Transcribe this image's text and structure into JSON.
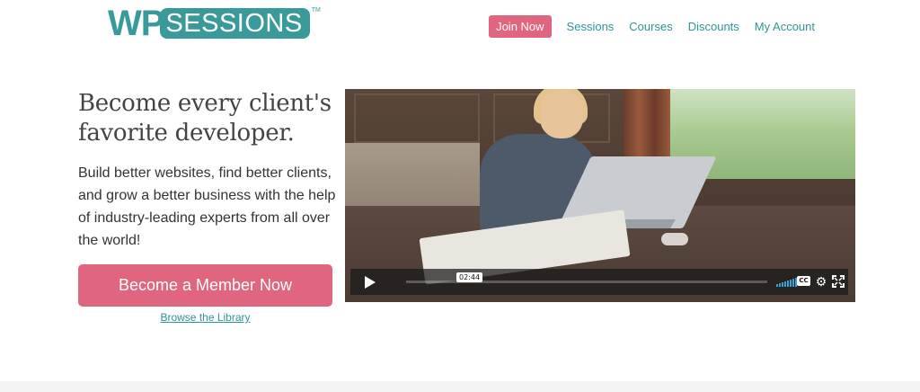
{
  "brand": {
    "logo_wp": "WP",
    "logo_sessions": "SESSIONS",
    "logo_tm": "TM",
    "primary_color": "#3a9a9b",
    "accent_color": "#e0667f"
  },
  "nav": {
    "join_label": "Join Now",
    "items": [
      "Sessions",
      "Courses",
      "Discounts",
      "My Account"
    ]
  },
  "hero": {
    "title": "Become every client's favorite developer.",
    "description": "Build better websites, find better clients, and grow a better business with the help of industry-leading experts from all over the world!",
    "cta_label": "Become a Member Now",
    "browse_label": "Browse the Library"
  },
  "video": {
    "timecode": "02:44",
    "cc_label": "CC",
    "progress_fraction": 0.0,
    "icons": [
      "play-icon",
      "volume-icon",
      "cc-icon",
      "gear-icon",
      "fullscreen-icon"
    ]
  }
}
